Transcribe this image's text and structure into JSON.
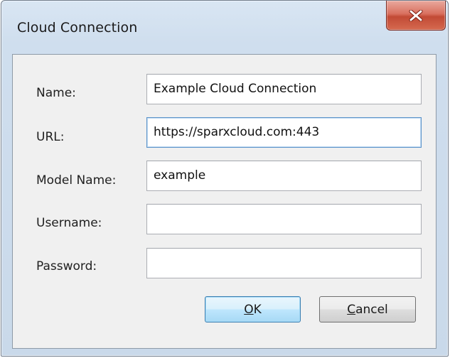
{
  "window": {
    "title": "Cloud Connection",
    "close_icon": "close-x-icon",
    "close_color": "#c24a35"
  },
  "form": {
    "fields": [
      {
        "label": "Name:",
        "value": "Example Cloud Connection",
        "focused": false
      },
      {
        "label": "URL:",
        "value": "https://sparxcloud.com:443",
        "focused": true
      },
      {
        "label": "Model Name:",
        "value": "example",
        "focused": false
      },
      {
        "label": "Username:",
        "value": "",
        "focused": false
      },
      {
        "label": "Password:",
        "value": "",
        "focused": false
      }
    ]
  },
  "buttons": {
    "ok": {
      "mnemonic": "O",
      "rest": "K"
    },
    "cancel": {
      "mnemonic": "C",
      "rest": "ancel"
    }
  }
}
